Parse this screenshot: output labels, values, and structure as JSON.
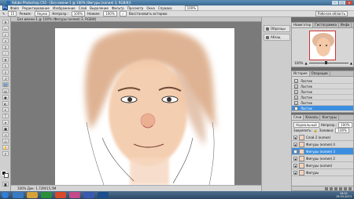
{
  "window": {
    "title": "Adobe Photoshop CS5 - [Без имени-1 @ 100% (Фигуры (копия) 3, RGB/8)]",
    "buttons": [
      "–",
      "□",
      "×"
    ]
  },
  "menubar": {
    "logo": "Ps",
    "items": [
      "Файл",
      "Редактирование",
      "Изображение",
      "Слой",
      "Выделение",
      "Фильтр",
      "Просмотр",
      "Окно",
      "Справка"
    ],
    "zoom": "100%"
  },
  "options": {
    "brush_size": "15",
    "mode_label": "Режим:",
    "mode_value": "Норма",
    "opacity_label": "Непрозр.:",
    "opacity_value": "100%",
    "flow_label": "Нажим:",
    "flow_value": "100%",
    "history_label": "Восстановить историю",
    "workspace": "Рабочая область"
  },
  "document": {
    "tab": "Без имени-1 @ 100% (Фигуры (копия) 3, RGB/8)",
    "status": "100%   Док: 1,72M/15,5M"
  },
  "panel_strip": {
    "items": [
      "Образцы",
      "Абзац"
    ]
  },
  "navigator": {
    "tabs": [
      "Навигатор",
      "Гистограмма",
      "Инфо"
    ],
    "zoom": "100%"
  },
  "history": {
    "tabs": [
      "История",
      "Операции"
    ],
    "rows": [
      "Ластик",
      "Ластик",
      "Ластик",
      "Ластик",
      "Ластик",
      "Ластик"
    ],
    "selected_index": 5
  },
  "layers": {
    "tabs": [
      "Слои",
      "Каналы",
      "Контуры"
    ],
    "blend_mode": "Нормальный",
    "opacity_label": "Непрозр.:",
    "opacity_value": "100%",
    "fill_label": "Заливка:",
    "fill_value": "100%",
    "lock_label": "Закрепить:",
    "rows": [
      {
        "name": "Слой 2 (копия)"
      },
      {
        "name": "Фигуры (копия) 4"
      },
      {
        "name": "Фигуры (копия) 3"
      },
      {
        "name": "Фигуры (копия) 2"
      },
      {
        "name": "Фигуры (копия)"
      },
      {
        "name": "Фигуры"
      }
    ],
    "selected_index": 2
  },
  "taskbar": {
    "time": "16:01",
    "date": "19.03.2013",
    "colors": {
      "start": "#2f7fd8",
      "active": "#5d7f9e"
    }
  },
  "colors": {
    "accent": "#3b8ee0",
    "skin": "#f3c9a8",
    "hair": "#d49a70"
  }
}
